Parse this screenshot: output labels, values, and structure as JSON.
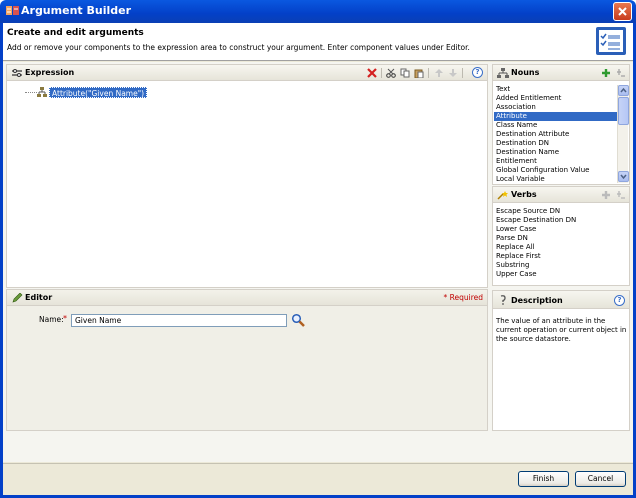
{
  "window": {
    "title": "Argument Builder"
  },
  "header": {
    "title": "Create and edit arguments",
    "subtitle": "Add or remove your components to the expression area to construct your argument. Enter component values under Editor."
  },
  "expression": {
    "title": "Expression",
    "tree_node": "Attribute(\"Given Name\")"
  },
  "editor": {
    "title": "Editor",
    "required_label": "* Required",
    "name_label": "Name:",
    "name_required_mark": "*",
    "name_value": "Given Name"
  },
  "nouns": {
    "title": "Nouns",
    "items": [
      "Text",
      "Added Entitlement",
      "Association",
      "Attribute",
      "Class Name",
      "Destination Attribute",
      "Destination DN",
      "Destination Name",
      "Entitlement",
      "Global Configuration Value",
      "Local Variable"
    ],
    "selected_index": 3
  },
  "verbs": {
    "title": "Verbs",
    "items": [
      "Escape Source DN",
      "Escape Destination DN",
      "Lower Case",
      "Parse DN",
      "Replace All",
      "Replace First",
      "Substring",
      "Upper Case"
    ]
  },
  "description": {
    "title": "Description",
    "text": "The value of an attribute in the current operation or current object in the source datastore."
  },
  "buttons": {
    "finish": "Finish",
    "cancel": "Cancel"
  },
  "colors": {
    "selection": "#316ac5",
    "title_bar": "#0340c8",
    "required": "#c00000"
  }
}
